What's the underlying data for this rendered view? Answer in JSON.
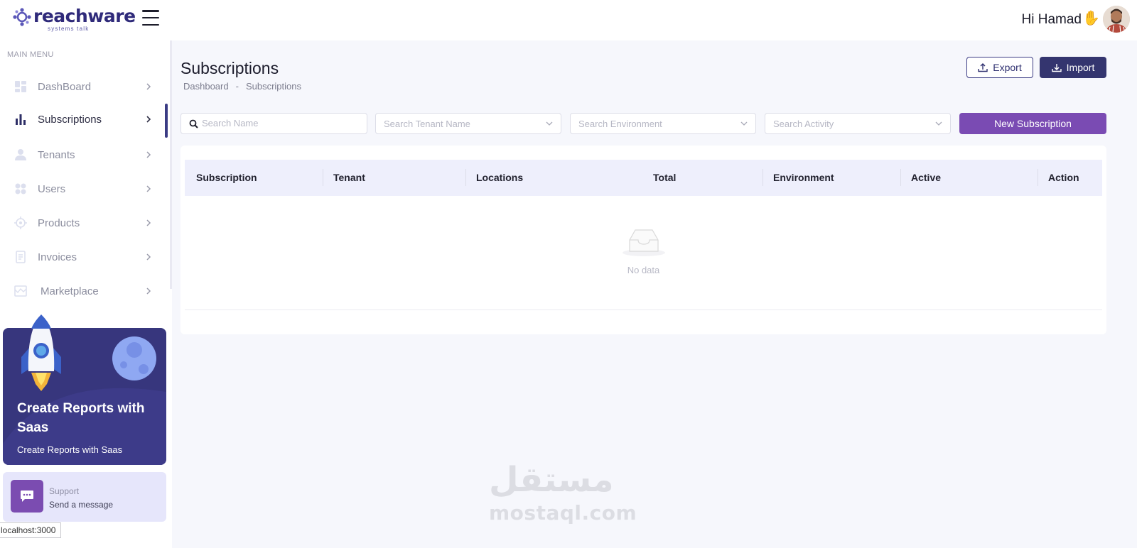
{
  "header": {
    "logo_text": "reachware",
    "logo_tagline": "systems talk",
    "greeting": "Hi Hamad",
    "wave_icon": "waving-hand-icon"
  },
  "sidebar": {
    "menu_title": "MAIN MENU",
    "items": [
      {
        "label": "DashBoard",
        "icon": "dashboard-icon",
        "active": false
      },
      {
        "label": "Subscriptions",
        "icon": "bar-chart-icon",
        "active": true
      },
      {
        "label": "Tenants",
        "icon": "user-icon",
        "active": false
      },
      {
        "label": "Users",
        "icon": "users-grid-icon",
        "active": false
      },
      {
        "label": "Products",
        "icon": "target-icon",
        "active": false
      },
      {
        "label": "Invoices",
        "icon": "document-icon",
        "active": false
      },
      {
        "label": "Marketplace",
        "icon": "storefront-icon",
        "active": false
      }
    ],
    "promo": {
      "title": "Create Reports with Saas",
      "subtitle": "Create Reports with Saas"
    },
    "support": {
      "title": "Support",
      "subtitle": "Send a message"
    }
  },
  "status_bar": {
    "url": "localhost:3000"
  },
  "page": {
    "title": "Subscriptions",
    "breadcrumb": [
      "Dashboard",
      "-",
      "Subscriptions"
    ],
    "export_label": "Export",
    "import_label": "Import",
    "new_label": "New Subscription"
  },
  "filters": {
    "search_name_placeholder": "Search Name",
    "tenant_placeholder": "Search Tenant Name",
    "environment_placeholder": "Search Environment",
    "activity_placeholder": "Search Activity"
  },
  "table": {
    "columns": [
      "Subscription",
      "Tenant",
      "Locations",
      "Total",
      "Environment",
      "Active",
      "Action"
    ],
    "rows": [],
    "empty_text": "No data"
  },
  "watermark": {
    "arabic": "مستقل",
    "latin": "mostaql.com"
  },
  "colors": {
    "brand": "#2f2a7a",
    "primary": "#34356f",
    "accent": "#7a4bb3",
    "background": "#f6f7fc"
  }
}
